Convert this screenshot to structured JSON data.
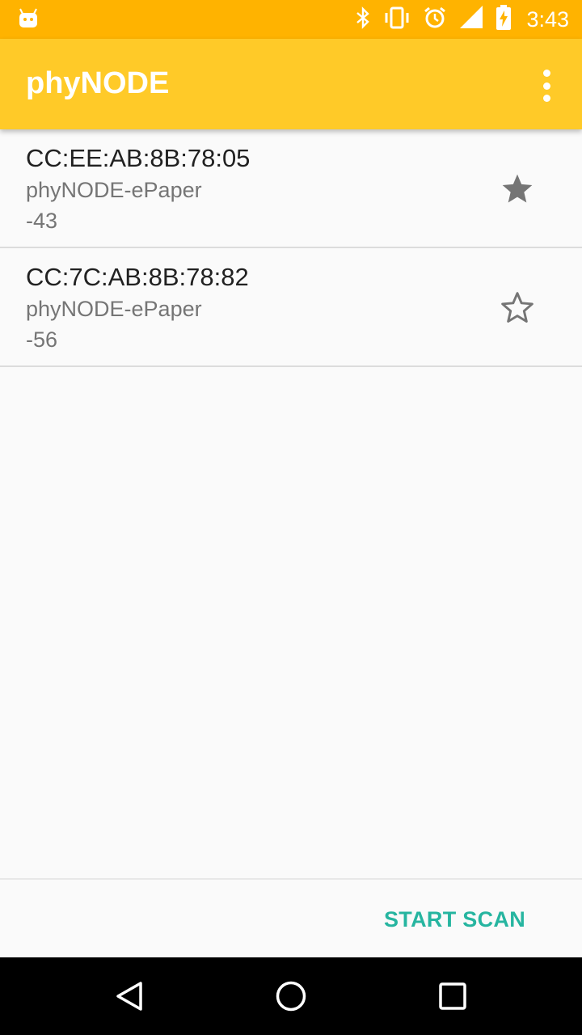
{
  "status_bar": {
    "time": "3:43",
    "icons": [
      "android-icon",
      "bluetooth-icon",
      "vibrate-icon",
      "alarm-icon",
      "signal-icon",
      "battery-charging-icon"
    ]
  },
  "app_bar": {
    "title": "phyNODE",
    "menu_icon": "overflow-menu-icon"
  },
  "devices": [
    {
      "address": "CC:EE:AB:8B:78:05",
      "name": "phyNODE-ePaper",
      "rssi": "-43",
      "favorite": true
    },
    {
      "address": "CC:7C:AB:8B:78:82",
      "name": "phyNODE-ePaper",
      "rssi": "-56",
      "favorite": false
    }
  ],
  "actions": {
    "scan_label": "START SCAN"
  },
  "nav_bar": {
    "buttons": [
      "back-icon",
      "home-icon",
      "recents-icon"
    ]
  },
  "colors": {
    "status_bar": "#ffb300",
    "app_bar": "#ffca28",
    "accent": "#26b5a0"
  }
}
